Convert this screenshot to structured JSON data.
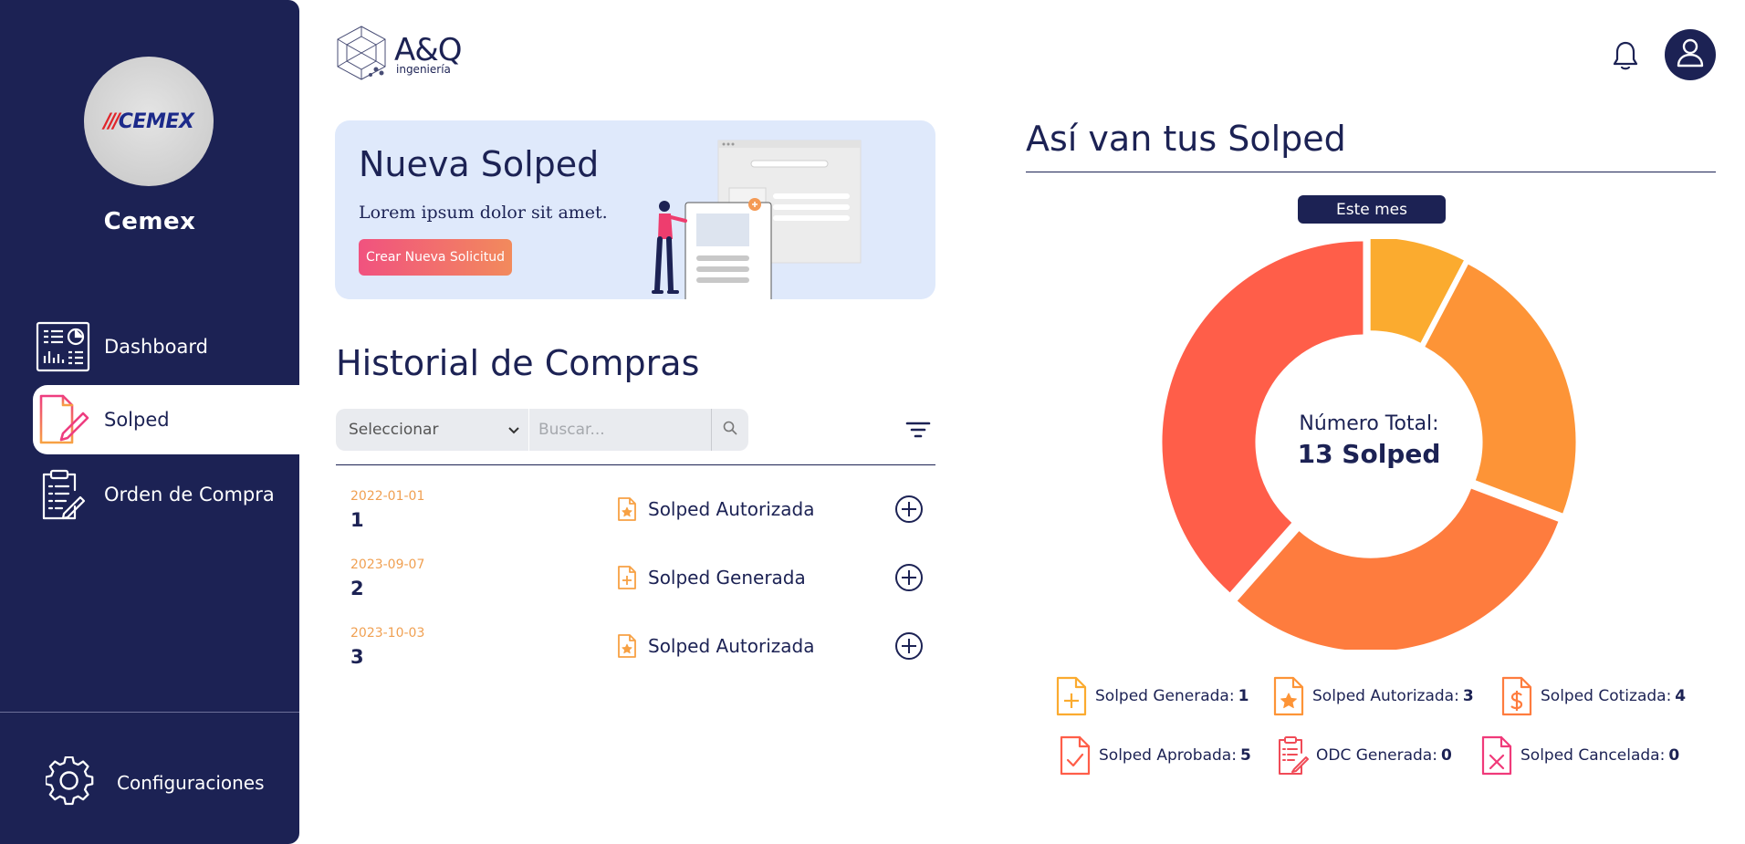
{
  "company": {
    "logo_text": "CEMEX",
    "name": "Cemex"
  },
  "nav": {
    "items": [
      {
        "label": "Dashboard",
        "icon": "dashboard-icon",
        "active": false
      },
      {
        "label": "Solped",
        "icon": "solped-icon",
        "active": true
      },
      {
        "label": "Orden de Compra",
        "icon": "clipboard-icon",
        "active": false
      }
    ],
    "settings_label": "Configuraciones"
  },
  "brand": {
    "name": "A&Q",
    "sub": "ingeniería"
  },
  "banner": {
    "title": "Nueva Solped",
    "subtitle": "Lorem ipsum dolor sit amet.",
    "button_label": "Crear Nueva Solicitud"
  },
  "history": {
    "title": "Historial de Compras",
    "select_value": "Seleccionar",
    "search_placeholder": "Buscar...",
    "rows": [
      {
        "date": "2022-01-01",
        "id": "1",
        "status": "Solped Autorizada",
        "status_icon": "doc-star-icon"
      },
      {
        "date": "2023-09-07",
        "id": "2",
        "status": "Solped Generada",
        "status_icon": "doc-plus-icon"
      },
      {
        "date": "2023-10-03",
        "id": "3",
        "status": "Solped Autorizada",
        "status_icon": "doc-star-icon"
      }
    ]
  },
  "chart_panel": {
    "title": "Así van tus Solped",
    "period_label": "Este mes",
    "center_line1": "Número Total:",
    "center_line2": "13 Solped"
  },
  "chart_data": {
    "type": "pie",
    "title": "",
    "total": 13,
    "series": [
      {
        "name": "Solped Generada",
        "value": 1,
        "color": "#fbab2f"
      },
      {
        "name": "Solped Autorizada",
        "value": 3,
        "color": "#fd9437"
      },
      {
        "name": "Solped Cotizada",
        "value": 4,
        "color": "#fe7c3e"
      },
      {
        "name": "Solped Aprobada",
        "value": 5,
        "color": "#ff5e49"
      },
      {
        "name": "ODC Generada",
        "value": 0,
        "color": "#f04b57"
      },
      {
        "name": "Solped Cancelada",
        "value": 0,
        "color": "#f03a7a"
      }
    ]
  },
  "legend": [
    {
      "label": "Solped Generada:",
      "value": "1",
      "icon": "doc-plus-icon",
      "color": "#fbab2f"
    },
    {
      "label": "Solped Autorizada:",
      "value": "3",
      "icon": "doc-star-icon",
      "color": "#fd9437"
    },
    {
      "label": "Solped Cotizada:",
      "value": "4",
      "icon": "doc-dollar-icon",
      "color": "#fe7c3e"
    },
    {
      "label": "Solped Aprobada:",
      "value": "5",
      "icon": "doc-check-icon",
      "color": "#ff5e49"
    },
    {
      "label": "ODC Generada:",
      "value": "0",
      "icon": "doc-list-icon",
      "color": "#f04b57"
    },
    {
      "label": "Solped Cancelada:",
      "value": "0",
      "icon": "doc-x-icon",
      "color": "#f03a7a"
    }
  ]
}
